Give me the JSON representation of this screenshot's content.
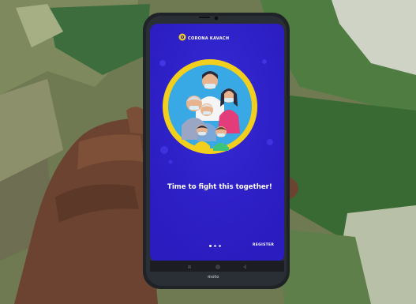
{
  "app": {
    "name": "CORONA KAVACH",
    "headline": "Time to fight this together!",
    "register_label": "REGISTER"
  },
  "pager": {
    "count": 3,
    "active": 1
  },
  "phone": {
    "brand": "moto"
  },
  "colors": {
    "screen_bg": "#2e20c6",
    "ring": "#f2cf1d",
    "circle_bg": "#39a9e6",
    "background_grass": "#6f7a52"
  }
}
